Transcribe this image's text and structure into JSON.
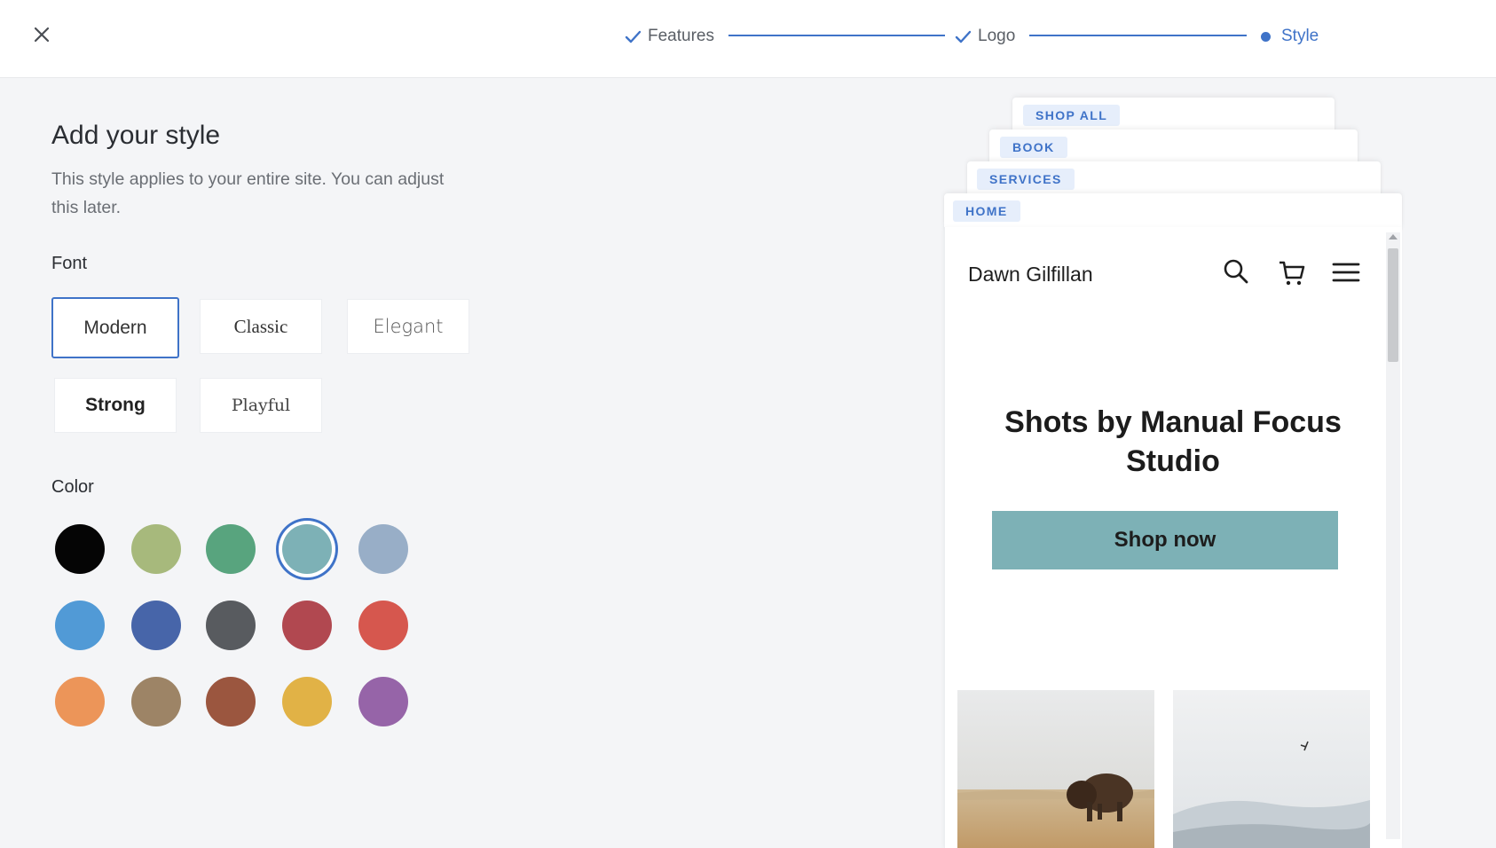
{
  "header": {
    "close_icon": "close-icon",
    "steps": [
      {
        "label": "Features",
        "state": "done",
        "icon": "check-icon"
      },
      {
        "label": "Logo",
        "state": "done",
        "icon": "check-icon"
      },
      {
        "label": "Style",
        "state": "current",
        "icon": "dot-icon"
      }
    ],
    "accent_color": "#3f73c8"
  },
  "panel": {
    "title": "Add your style",
    "subtitle": "This style applies to your entire site. You can adjust this later.",
    "font_label": "Font",
    "fonts": [
      {
        "label": "Modern",
        "selected": true
      },
      {
        "label": "Classic",
        "selected": false
      },
      {
        "label": "Elegant",
        "selected": false
      },
      {
        "label": "Strong",
        "selected": false
      },
      {
        "label": "Playful",
        "selected": false
      }
    ],
    "color_label": "Color",
    "colors": [
      {
        "hex": "#050505",
        "selected": false
      },
      {
        "hex": "#a7b97c",
        "selected": false
      },
      {
        "hex": "#58a47e",
        "selected": false
      },
      {
        "hex": "#7db1b6",
        "selected": true
      },
      {
        "hex": "#98aec7",
        "selected": false
      },
      {
        "hex": "#519ad6",
        "selected": false
      },
      {
        "hex": "#4765a9",
        "selected": false
      },
      {
        "hex": "#585b5f",
        "selected": false
      },
      {
        "hex": "#b14850",
        "selected": false
      },
      {
        "hex": "#d6574e",
        "selected": false
      },
      {
        "hex": "#ec9559",
        "selected": false
      },
      {
        "hex": "#9d8466",
        "selected": false
      },
      {
        "hex": "#9b563f",
        "selected": false
      },
      {
        "hex": "#e1b246",
        "selected": false
      },
      {
        "hex": "#9664a8",
        "selected": false
      }
    ]
  },
  "preview": {
    "tabs": [
      "SHOP ALL",
      "BOOK",
      "SERVICES",
      "HOME"
    ],
    "site_name": "Dawn Gilfillan",
    "icons": [
      "search-icon",
      "cart-icon",
      "menu-icon"
    ],
    "hero_title": "Shots by Manual Focus Studio",
    "cta_label": "Shop now",
    "images": [
      "bison-photo",
      "misty-landscape-photo"
    ]
  }
}
